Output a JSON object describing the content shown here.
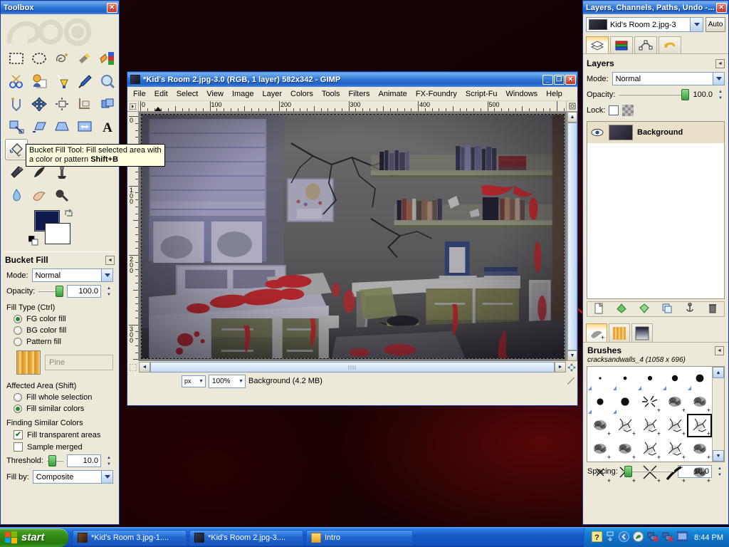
{
  "desktop": {
    "background_color": "#140203",
    "accent_red": "#c21a1a"
  },
  "toolbox": {
    "title": "Toolbox",
    "close_label": "✕",
    "tools_row1": [
      "rect-select-tool",
      "ellipse-select-tool",
      "free-select-tool",
      "fuzzy-select-tool",
      "select-by-color-tool"
    ],
    "tools_row2": [
      "scissors-select-tool",
      "foreground-select-tool",
      "paths-tool",
      "color-picker-tool",
      "zoom-tool"
    ],
    "tools_row3": [
      "measure-tool",
      "move-tool",
      "alignment-tool",
      "crop-tool",
      "rotate-tool"
    ],
    "tools_row4": [
      "scale-tool",
      "shear-tool",
      "perspective-tool",
      "flip-tool",
      "text-tool"
    ],
    "tools_row5": [
      "bucket-fill-tool",
      "blend-tool",
      "pencil-tool",
      "paintbrush-tool",
      "eraser-tool"
    ],
    "tools_row6": [
      "airbrush-tool",
      "ink-tool",
      "clone-tool",
      "heal-tool",
      "perspective-clone-tool"
    ],
    "tools_row7": [
      "blur-sharpen-tool",
      "smudge-tool",
      "dodge-burn-tool"
    ],
    "selected_tool": "bucket-fill-tool",
    "fg_color": "#101a4a",
    "bg_color": "#ffffff"
  },
  "tooltip": {
    "text": "Bucket Fill Tool: Fill selected area with a color or pattern",
    "shortcut": "Shift+B"
  },
  "tool_options": {
    "title": "Bucket Fill",
    "mode_label": "Mode:",
    "mode_value": "Normal",
    "opacity_label": "Opacity:",
    "opacity_value": "100.0",
    "fill_type_label": "Fill Type  (Ctrl)",
    "fill_type_options": [
      {
        "label": "FG color fill",
        "selected": true
      },
      {
        "label": "BG color fill",
        "selected": false
      },
      {
        "label": "Pattern fill",
        "selected": false
      }
    ],
    "pattern_name": "Pine",
    "affected_area_label": "Affected Area  (Shift)",
    "affected_area_options": [
      {
        "label": "Fill whole selection",
        "selected": false
      },
      {
        "label": "Fill similar colors",
        "selected": true
      }
    ],
    "finding_label": "Finding Similar Colors",
    "checkboxes": [
      {
        "label": "Fill transparent areas",
        "checked": true
      },
      {
        "label": "Sample merged",
        "checked": false
      }
    ],
    "threshold_label": "Threshold:",
    "threshold_value": "10.0",
    "fill_by_label": "Fill by:",
    "fill_by_value": "Composite"
  },
  "image_window": {
    "title": "*Kid's Room 2.jpg-3.0 (RGB, 1 layer) 582x342 - GIMP",
    "minimize_label": "_",
    "maximize_label": "❐",
    "close_label": "✕",
    "menus": [
      "File",
      "Edit",
      "Select",
      "View",
      "Image",
      "Layer",
      "Colors",
      "Tools",
      "Filters",
      "Animate",
      "FX-Foundry",
      "Script-Fu",
      "Windows",
      "Help"
    ],
    "ruler_h_labels": [
      "0",
      "100",
      "200",
      "300",
      "400",
      "500"
    ],
    "ruler_v_labels": [
      "0",
      "100",
      "200",
      "300"
    ],
    "unit_value": "px",
    "zoom_value": "100%",
    "status_text": "Background (4.2 MB)"
  },
  "dock": {
    "title": "Layers, Channels, Paths, Undo -...",
    "close_label": "✕",
    "image_name": "Kid's Room 2.jpg-3",
    "auto_label": "Auto",
    "tabs": [
      "layers-tab",
      "channels-tab",
      "paths-tab",
      "undo-history-tab"
    ],
    "layers_panel": {
      "title": "Layers",
      "mode_label": "Mode:",
      "mode_value": "Normal",
      "opacity_label": "Opacity:",
      "opacity_value": "100.0",
      "lock_label": "Lock:",
      "layers": [
        {
          "name": "Background",
          "visible": true
        }
      ]
    },
    "layer_buttons": [
      "new-layer-icon",
      "raise-layer-icon",
      "lower-layer-icon",
      "duplicate-layer-icon",
      "anchor-layer-icon",
      "delete-layer-icon"
    ],
    "bottom_tabs": [
      "brushes-tab",
      "patterns-tab",
      "gradients-tab"
    ],
    "brushes_panel": {
      "title": "Brushes",
      "current_brush": "cracksandwalls_4 (1058 x 696)",
      "spacing_label": "Spacing:",
      "spacing_value": "10.0",
      "selected_index": 14
    }
  },
  "taskbar": {
    "start_label": "start",
    "buttons": [
      {
        "label": "*Kid's Room 3.jpg-1...."
      },
      {
        "label": "*Kid's Room 2.jpg-3...."
      },
      {
        "label": "Intro"
      }
    ],
    "tray_icons": [
      "help-icon",
      "network-connections-icon",
      "show-desktop-icon",
      "media-icon",
      "network-disconnected-icon",
      "network-disconnected-icon-2",
      "monitor-icon"
    ],
    "clock": "8:44 PM"
  }
}
